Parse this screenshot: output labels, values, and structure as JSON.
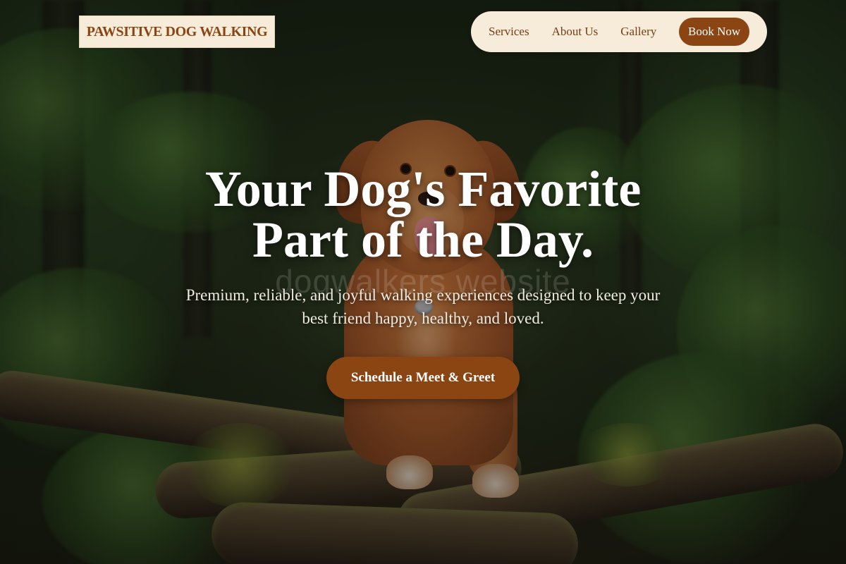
{
  "brand": {
    "logo_text": "PAWSITIVE DOG WALKING"
  },
  "nav": {
    "links": [
      {
        "label": "Services"
      },
      {
        "label": "About Us"
      },
      {
        "label": "Gallery"
      }
    ],
    "cta_label": "Book Now"
  },
  "hero": {
    "title_line1": "Your Dog's Favorite",
    "title_line2": "Part of the Day.",
    "watermark": "dogwalkers website",
    "subtitle": "Premium, reliable, and joyful walking experiences designed to keep your best friend happy, healthy, and loved.",
    "cta_label": "Schedule a Meet & Greet",
    "background_image": "golden dog in forest"
  },
  "colors": {
    "brand_brown": "#8b4513",
    "cream": "#f6ecd9",
    "title_text": "#ffffff"
  }
}
